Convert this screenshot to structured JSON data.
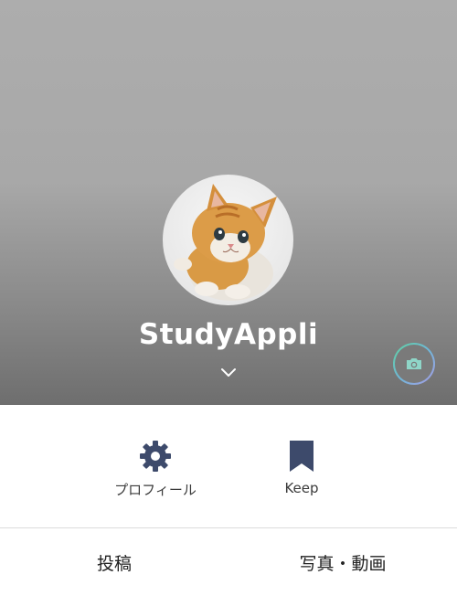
{
  "profile": {
    "username": "StudyAppli",
    "avatar_icon": "kitten-photo",
    "expand_icon": "chevron-down-icon",
    "camera_icon": "camera-icon"
  },
  "actions": [
    {
      "label": "プロフィール",
      "icon": "gear-icon"
    },
    {
      "label": "Keep",
      "icon": "bookmark-icon"
    }
  ],
  "tabs": [
    {
      "label": "投稿"
    },
    {
      "label": "写真・動画"
    }
  ],
  "colors": {
    "icon": "#3d4a6b",
    "camera_ring_start": "#5fd3a0",
    "camera_ring_end": "#a99be6"
  }
}
